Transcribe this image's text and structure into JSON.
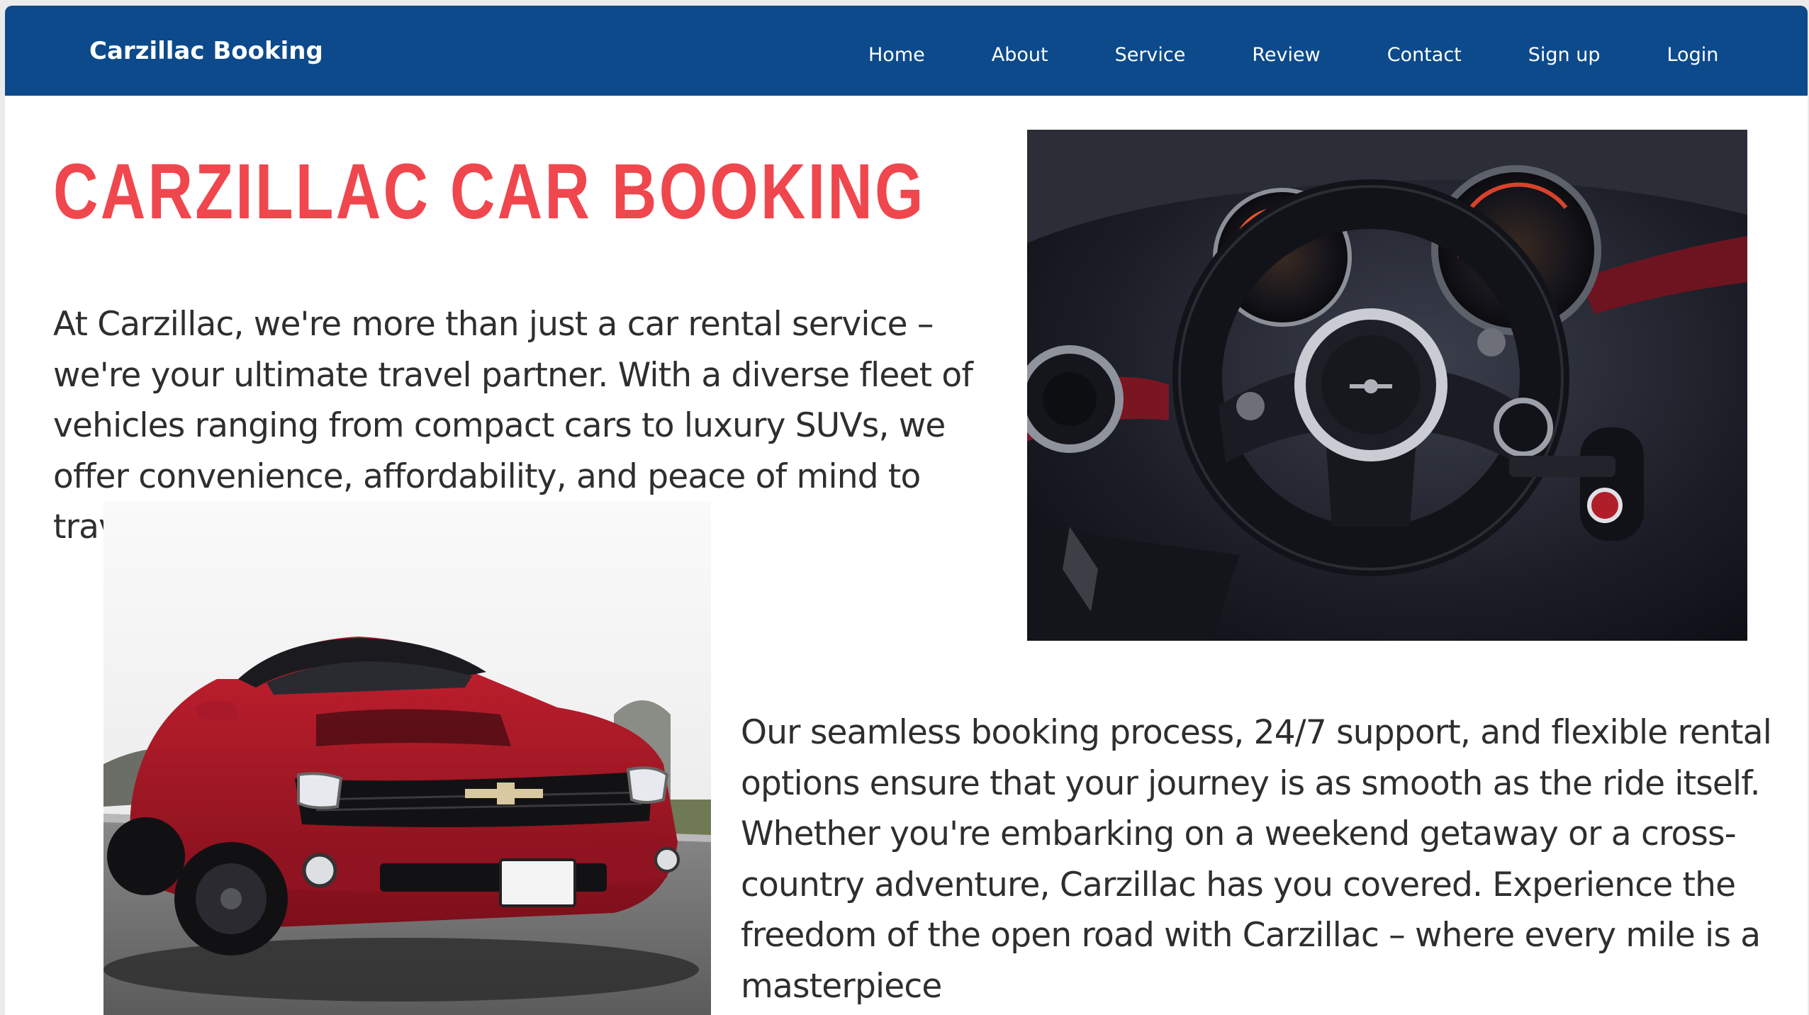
{
  "navbar": {
    "brand": "Carzillac Booking",
    "links": [
      {
        "label": "Home"
      },
      {
        "label": "About"
      },
      {
        "label": "Service"
      },
      {
        "label": "Review"
      },
      {
        "label": "Contact"
      },
      {
        "label": "Sign up"
      },
      {
        "label": "Login"
      }
    ]
  },
  "hero": {
    "title": "CARZILLAC CAR BOOKING",
    "paragraph_1": "At Carzillac, we're more than just a car rental service – we're your ultimate travel partner. With a diverse fleet of vehicles ranging from compact cars to luxury SUVs, we offer convenience, affordability, and peace of mind to travelers worldwide.",
    "paragraph_2": "Our seamless booking process, 24/7 support, and flexible rental options ensure that your journey is as smooth as the ride itself. Whether you're embarking on a weekend getaway or a cross-country adventure, Carzillac has you covered. Experience the freedom of the open road with Carzillac – where every mile is a masterpiece"
  },
  "images": {
    "interior": {
      "subject": "car-interior-steering-wheel"
    },
    "car": {
      "subject": "red-sports-car"
    }
  },
  "colors": {
    "nav_background": "#0c4a8b",
    "title_red": "#ef474d",
    "body_text": "#2e2e2e"
  }
}
